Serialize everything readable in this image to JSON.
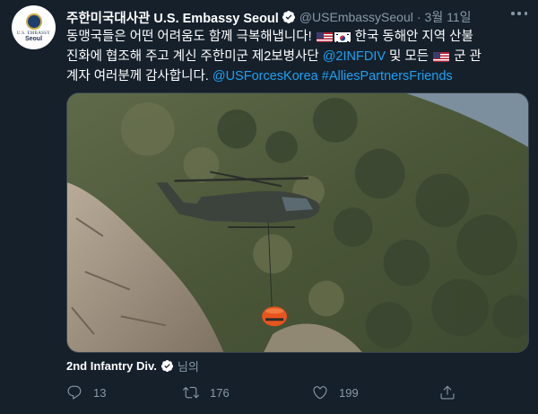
{
  "author": {
    "avatar": {
      "org": "U.S. EMBASSY",
      "city": "Seoul"
    },
    "display_name": "주한미국대사관 U.S. Embassy Seoul",
    "handle": "@USEmbassySeoul",
    "separator": "·",
    "date": "3월 11일"
  },
  "tweet": {
    "line1_text": "동맹국들은 어떤 어려움도 함께 극복해냅니다!",
    "line1_text_b": "한국 동해안 지역 산불",
    "line2_text": "진화에 협조해 주고 계신 주한미군 제2보병사단",
    "line2_mention": "@2INFDIV",
    "line2_text_b": "및 모든",
    "line2_text_c": "군 관",
    "line3_text": "계자 여러분께 감사합니다.",
    "line3_mention": "@USForcesKorea",
    "line3_hashtag": "#AlliesPartnersFriends",
    "flags": [
      "us-flag-icon",
      "korea-flag-icon",
      "us-flag-icon"
    ]
  },
  "media": {
    "description_icons": [
      "helicopter",
      "water-bucket",
      "mountain"
    ]
  },
  "attribution": {
    "name": "2nd Infantry Div.",
    "suffix": "님의"
  },
  "actions": {
    "reply_count": "13",
    "retweet_count": "176",
    "like_count": "199"
  },
  "colors": {
    "background": "#15202b",
    "text": "#ffffff",
    "secondary": "#8899a6",
    "accent": "#1da1f2"
  }
}
